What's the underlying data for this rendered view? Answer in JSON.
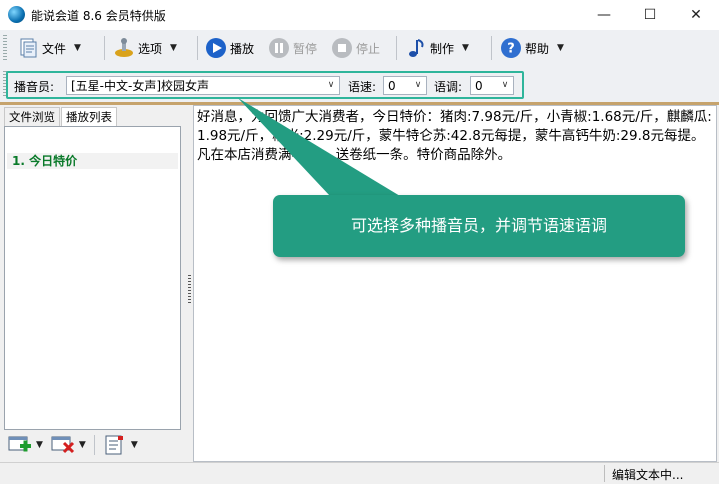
{
  "window": {
    "title": "能说会道 8.6 会员特供版",
    "minimize_glyph": "—",
    "maximize_glyph": "☐",
    "close_glyph": "✕"
  },
  "toolbar": {
    "file_label": "文件",
    "options_label": "选项",
    "play_label": "播放",
    "pause_label": "暂停",
    "stop_label": "停止",
    "make_label": "制作",
    "help_label": "帮助",
    "dropdown_glyph": "▼"
  },
  "voice": {
    "voice_label": "播音员:",
    "voice_value": "[五星-中文-女声]校园女声",
    "speed_label": "语速:",
    "speed_value": "0",
    "pitch_label": "语调:",
    "pitch_value": "0",
    "combo_arrow": "∨"
  },
  "left_panel": {
    "tabs": [
      {
        "label": "文件浏览",
        "active": false
      },
      {
        "label": "播放列表",
        "active": true
      }
    ],
    "playlist": [
      {
        "label": "1.  今日特价"
      }
    ]
  },
  "editor": {
    "text": "好消息，为回馈广大消费者，今日特价：猪肉:7.98元/斤，小青椒:1.68元/斤，麒麟瓜:1.98元/斤，糯米:2.29元/斤，蒙牛特仑苏:42.8元每提，蒙牛高钙牛奶:29.8元每提。凡在本店消费满48元，送卷纸一条。特价商品除外。"
  },
  "callout": {
    "text": "可选择多种播音员，并调节语速语调",
    "color": "#239d82"
  },
  "status": {
    "text": "编辑文本中..."
  },
  "colors": {
    "accent_frame": "#2fb59b",
    "playlist_text": "#0a7a2a"
  }
}
